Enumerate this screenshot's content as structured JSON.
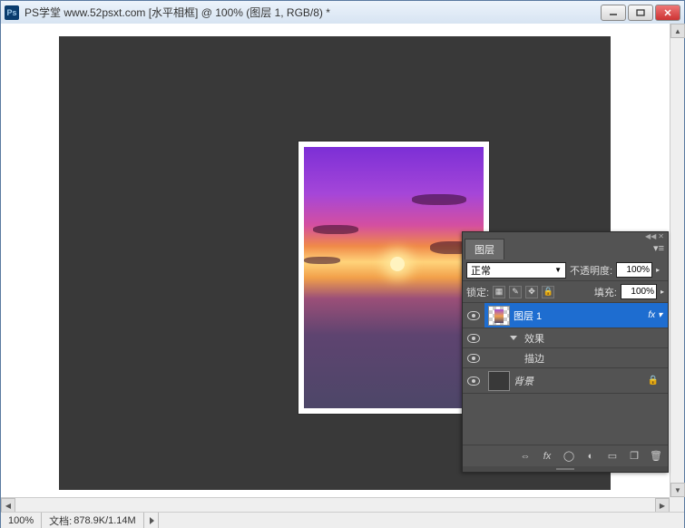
{
  "titlebar": {
    "app_icon_text": "Ps",
    "title": "PS学堂 www.52psxt.com [水平相框] @ 100% (图层 1, RGB/8) *"
  },
  "statusbar": {
    "zoom": "100%",
    "doc_label": "文档:",
    "doc_value": "878.9K/1.14M"
  },
  "layers_panel": {
    "tab": "图层",
    "blend_mode": "正常",
    "opacity_label": "不透明度:",
    "opacity_value": "100%",
    "lock_label": "锁定:",
    "fill_label": "填充:",
    "fill_value": "100%",
    "layers": [
      {
        "name": "图层 1",
        "fx": "fx",
        "selected": true
      },
      {
        "name": "效果"
      },
      {
        "name": "描边"
      },
      {
        "name": "背景"
      }
    ]
  }
}
